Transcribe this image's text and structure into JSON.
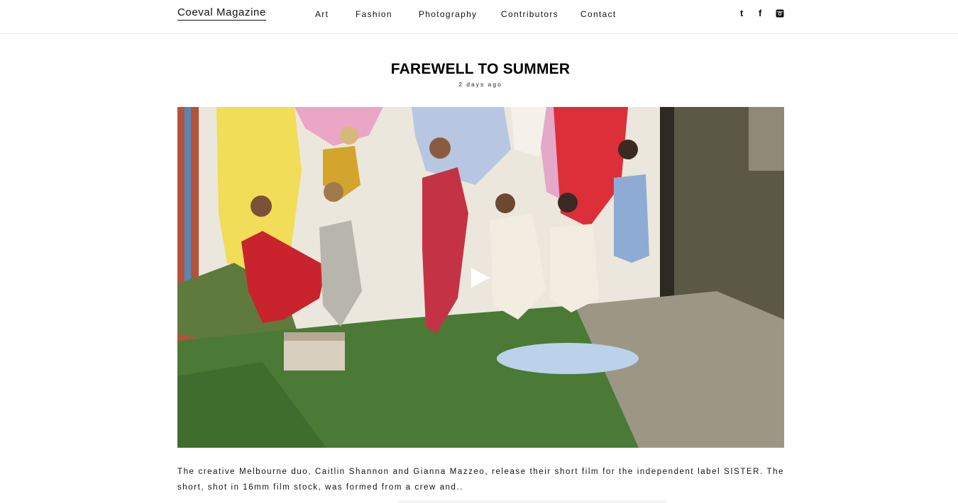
{
  "header": {
    "brand": "Coeval Magazine",
    "nav": [
      {
        "label": "Art"
      },
      {
        "label": "Fashion"
      },
      {
        "label": "Photography"
      },
      {
        "label": "Contributors"
      },
      {
        "label": "Contact"
      }
    ],
    "social": {
      "tumblr_glyph": "t",
      "facebook_glyph": "f",
      "icons": [
        "tumblr-icon",
        "facebook-icon",
        "instagram-icon"
      ]
    }
  },
  "article": {
    "title": "FAREWELL TO SUMMER",
    "date": "2 days ago",
    "media": {
      "type": "video",
      "icon": "play-icon"
    },
    "excerpt": "The creative Melbourne duo, Caitlin Shannon and Gianna Mazzeo, release their short film for the independent label SISTER. The short, shot in 16mm film stock, was formed from a crew and.."
  },
  "colors": {
    "text": "#111111",
    "divider": "#e8e8e8",
    "background": "#ffffff"
  }
}
